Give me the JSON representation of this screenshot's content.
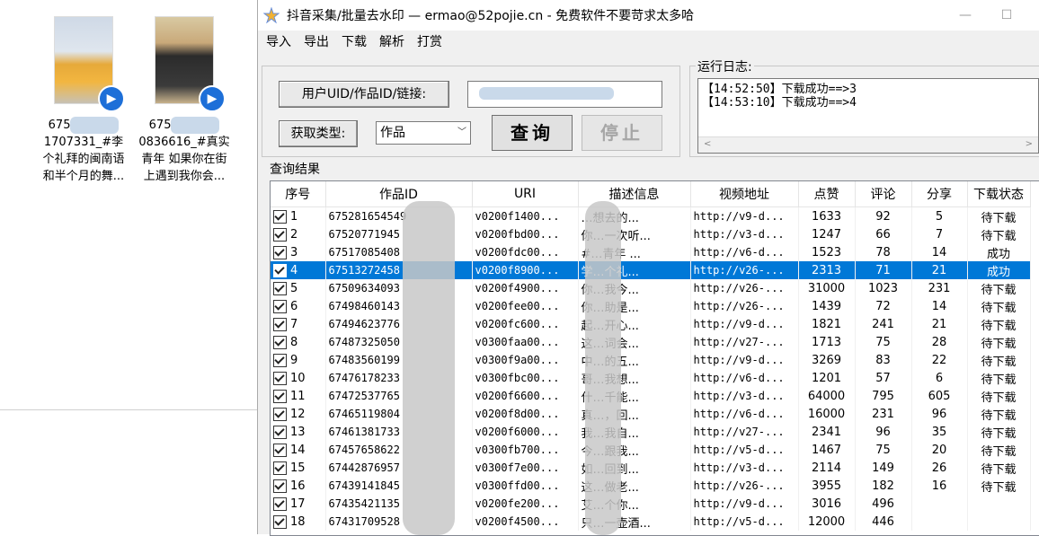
{
  "desktop": {
    "files": [
      {
        "name_line1": "675",
        "name_line2": "1707331_#李",
        "name_line3": "个礼拜的闽南语",
        "name_line4": "和半个月的舞..."
      },
      {
        "name_line1": "675",
        "name_line2": "0836616_#真实",
        "name_line3": "青年 如果你在街",
        "name_line4": "上遇到我你会..."
      }
    ]
  },
  "window": {
    "title": "抖音采集/批量去水印 — ermao@52pojie.cn - 免费软件不要苛求太多哈",
    "minimize": "—",
    "maximize": "☐"
  },
  "menu": [
    "导入",
    "导出",
    "下载",
    "解析",
    "打赏"
  ],
  "form": {
    "uid_label": "用户UID/作品ID/链接:",
    "uid_value": "",
    "type_label": "获取类型:",
    "type_selected": "作品",
    "query_button": "查询",
    "stop_button": "停止"
  },
  "log": {
    "label": "运行日志:",
    "lines": [
      "【14:52:50】下载成功==>3",
      "【14:53:10】下载成功==>4"
    ],
    "scroll_left": "<",
    "scroll_right": ">"
  },
  "results": {
    "label": "查询结果",
    "columns": [
      "序号",
      "作品ID",
      "URI",
      "描述信息",
      "视频地址",
      "点赞",
      "评论",
      "分享",
      "下载状态"
    ],
    "rows": [
      [
        "1",
        "675281654549",
        "v0200f1400...",
        "…想去的...",
        "http://v9-d...",
        "1633",
        "92",
        "5",
        "待下载"
      ],
      [
        "2",
        "67520771945",
        "v0200fbd00...",
        "你…一次听...",
        "http://v3-d...",
        "1247",
        "66",
        "7",
        "待下载"
      ],
      [
        "3",
        "67517085408",
        "v0200fdc00...",
        "#…青年 ...",
        "http://v6-d...",
        "1523",
        "78",
        "14",
        "成功"
      ],
      [
        "4",
        "67513272458",
        "v0200f8900...",
        "学…个礼...",
        "http://v26-...",
        "2313",
        "71",
        "21",
        "成功"
      ],
      [
        "5",
        "67509634093",
        "v0200f4900...",
        "你…我今...",
        "http://v26-...",
        "31000",
        "1023",
        "231",
        "待下载"
      ],
      [
        "6",
        "67498460143",
        "v0200fee00...",
        "你…助是...",
        "http://v26-...",
        "1439",
        "72",
        "14",
        "待下载"
      ],
      [
        "7",
        "67494623776",
        "v0200fc600...",
        "起…开心...",
        "http://v9-d...",
        "1821",
        "241",
        "21",
        "待下载"
      ],
      [
        "8",
        "67487325050",
        "v0300faa00...",
        "这…词会...",
        "http://v27-...",
        "1713",
        "75",
        "28",
        "待下载"
      ],
      [
        "9",
        "67483560199",
        "v0300f9a00...",
        "中…的五...",
        "http://v9-d...",
        "3269",
        "83",
        "22",
        "待下载"
      ],
      [
        "10",
        "67476178233",
        "v0300fbc00...",
        "哥…我想...",
        "http://v6-d...",
        "1201",
        "57",
        "6",
        "待下载"
      ],
      [
        "11",
        "67472537765",
        "v0200f6600...",
        "什…千能...",
        "http://v3-d...",
        "64000",
        "795",
        "605",
        "待下载"
      ],
      [
        "12",
        "67465119804",
        "v0200f8d00...",
        "真…，回...",
        "http://v6-d...",
        "16000",
        "231",
        "96",
        "待下载"
      ],
      [
        "13",
        "67461381733",
        "v0200f6000...",
        "我…我自...",
        "http://v27-...",
        "2341",
        "96",
        "35",
        "待下载"
      ],
      [
        "14",
        "67457658622",
        "v0300fb700...",
        "今…跟我...",
        "http://v5-d...",
        "1467",
        "75",
        "20",
        "待下载"
      ],
      [
        "15",
        "67442876957",
        "v0300f7e00...",
        "如…回到...",
        "http://v3-d...",
        "2114",
        "149",
        "26",
        "待下载"
      ],
      [
        "16",
        "67439141845",
        "v0300ffd00...",
        "这…做老...",
        "http://v26-...",
        "3955",
        "182",
        "16",
        "待下载"
      ],
      [
        "17",
        "67435421135",
        "v0200fe200...",
        "艾…个你...",
        "http://v9-d...",
        "3016",
        "496",
        "",
        ""
      ],
      [
        "18",
        "67431709528",
        "v0200f4500...",
        "只…一壶酒...",
        "http://v5-d...",
        "12000",
        "446",
        "",
        ""
      ]
    ],
    "selected_row": 3
  }
}
